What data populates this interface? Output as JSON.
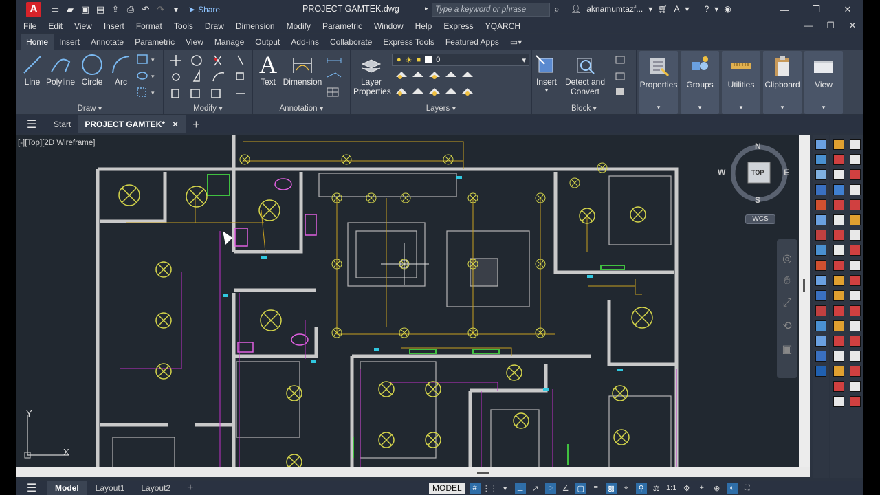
{
  "titlebar": {
    "logo": "A",
    "share_label": "Share",
    "document_title": "PROJECT GAMTEK.dwg",
    "search_placeholder": "Type a keyword or phrase",
    "username": "aknamumtazf..."
  },
  "menu": [
    "File",
    "Edit",
    "View",
    "Insert",
    "Format",
    "Tools",
    "Draw",
    "Dimension",
    "Modify",
    "Parametric",
    "Window",
    "Help",
    "Express",
    "YQARCH"
  ],
  "ribbon_tabs": [
    "Home",
    "Insert",
    "Annotate",
    "Parametric",
    "View",
    "Manage",
    "Output",
    "Add-ins",
    "Collaborate",
    "Express Tools",
    "Featured Apps"
  ],
  "active_ribbon_tab": "Home",
  "ribbon": {
    "draw": {
      "label": "Draw",
      "line": "Line",
      "polyline": "Polyline",
      "circle": "Circle",
      "arc": "Arc"
    },
    "modify": {
      "label": "Modify"
    },
    "annotation": {
      "label": "Annotation",
      "text": "Text",
      "dimension": "Dimension"
    },
    "layers": {
      "label": "Layers",
      "layer_properties": "Layer Properties",
      "current_layer": "0"
    },
    "block": {
      "label": "Block",
      "insert": "Insert",
      "detect_convert": "Detect and Convert"
    },
    "tools": [
      "Properties",
      "Groups",
      "Utilities",
      "Clipboard",
      "View"
    ]
  },
  "file_tabs": {
    "start": "Start",
    "active": "PROJECT GAMTEK*"
  },
  "viewport": {
    "label": "[-][Top][2D Wireframe]"
  },
  "viewcube": {
    "north": "N",
    "south": "S",
    "east": "E",
    "west": "W",
    "face": "TOP",
    "wcs": "WCS"
  },
  "ucs": {
    "x": "X",
    "y": "Y"
  },
  "colors": {
    "wall": "#c9c9c9",
    "light": "#d4d44a",
    "wire_yellow": "#c8a020",
    "wire_magenta": "#c030c8",
    "furniture": "#b5b5b5",
    "magenta_fixture": "#e060e0",
    "cyan": "#30c8e0",
    "green": "#40c040"
  },
  "statusbar": {
    "layouts": [
      "Model",
      "Layout1",
      "Layout2"
    ],
    "active_layout": "Model",
    "model_badge": "MODEL",
    "scale": "1:1"
  }
}
